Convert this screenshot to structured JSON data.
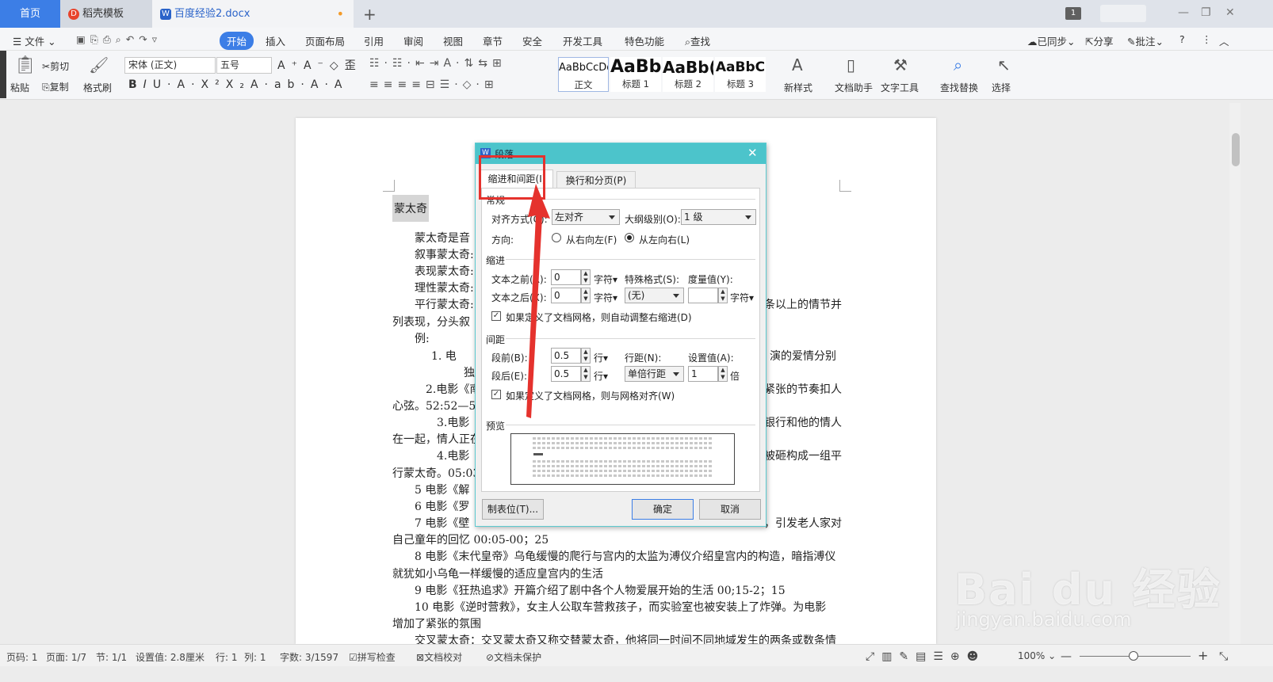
{
  "titlebar": {
    "tab_home": "首页",
    "tab_daoke": "稻壳模板",
    "tab_doc": "百度经验2.docx",
    "page_badge": "1"
  },
  "menubar": {
    "file": "文件",
    "items": [
      "开始",
      "插入",
      "页面布局",
      "引用",
      "审阅",
      "视图",
      "章节",
      "安全",
      "开发工具",
      "特色功能"
    ],
    "search": "查找",
    "sync": "已同步",
    "share": "分享",
    "comment": "批注"
  },
  "ribbon": {
    "paste": "粘贴",
    "cut": "剪切",
    "copy": "复制",
    "format_painter": "格式刷",
    "font_name": "宋体 (正文)",
    "font_size": "五号",
    "styles": [
      {
        "preview": "AaBbCcDd",
        "label": "正文"
      },
      {
        "preview": "AaBb",
        "label": "标题 1"
      },
      {
        "preview": "AaBb(",
        "label": "标题 2"
      },
      {
        "preview": "AaBbC",
        "label": "标题 3"
      }
    ],
    "new_style": "新样式",
    "doc_helper": "文档助手",
    "text_tools": "文字工具",
    "find_replace": "查找替换",
    "select": "选择"
  },
  "document": {
    "heading": "蒙太奇",
    "lines": [
      "蒙太奇是音",
      "叙事蒙太奇:",
      "表现蒙太奇:",
      "理性蒙太奇:",
      "平行蒙太奇:",
      "列表现，分头叙",
      "例:",
      "1.    电",
      "独",
      "2.电影《南",
      "心弦。52:52—54",
      "3.电影",
      "在一起，情人正在",
      "4.电影",
      "行蒙太奇。05:03",
      "5 电影《解",
      "6 电影《罗",
      "7 电影《壁"
    ],
    "right_frag": [
      "条以上的情节并",
      "演的爱情分别",
      "紧张的节奏扣人",
      "银行和他的情人",
      "被砸构成一组平",
      "，引发老人家对"
    ],
    "full": [
      "自己童年的回忆 00:05-00；25",
      "8 电影《末代皇帝》乌龟缓慢的爬行与宫内的太监为溥仪介绍皇宫内的构造，暗指溥仪",
      "就犹如小乌龟一样缓慢的适应皇宫内的生活",
      "9 电影《狂热追求》开篇介绍了剧中各个人物爱展开始的生活 00;15-2；15",
      "10 电影《逆时营救》，女主人公取车营救孩子，而实验室也被安装上了炸弹。为电影",
      "增加了紧张的氛围",
      "交叉蒙太奇：交叉蒙太奇又称交替蒙太奇，他将同一时间不同地域发生的两条或数条情"
    ]
  },
  "dialog": {
    "title": "段落",
    "tab1": "缩进和间距(I)",
    "tab2": "换行和分页(P)",
    "general": "常规",
    "align_label": "对齐方式(G):",
    "align_value": "左对齐",
    "outline_label": "大纲级别(O):",
    "outline_value": "1 级",
    "direction_label": "方向:",
    "rtl": "从右向左(F)",
    "ltr": "从左向右(L)",
    "indent": "缩进",
    "before_text_label": "文本之前(R):",
    "before_text_value": "0",
    "after_text_label": "文本之后(X):",
    "after_text_value": "0",
    "unit_char": "字符",
    "special_label": "特殊格式(S):",
    "special_value": "(无)",
    "measure_label": "度量值(Y):",
    "auto_indent": "如果定义了文档网格，则自动调整右缩进(D)",
    "spacing": "间距",
    "before_label": "段前(B):",
    "before_value": "0.5",
    "after_label": "段后(E):",
    "after_value": "0.5",
    "unit_line": "行",
    "line_spacing_label": "行距(N):",
    "line_spacing_value": "单倍行距",
    "set_value_label": "设置值(A):",
    "set_value": "1",
    "unit_times": "倍",
    "snap_grid": "如果定义了文档网格，则与网格对齐(W)",
    "preview": "预览",
    "tabs_button": "制表位(T)...",
    "ok": "确定",
    "cancel": "取消"
  },
  "status": {
    "page": "页码: 1",
    "pages": "页面: 1/7",
    "section": "节: 1/1",
    "setting": "设置值: 2.8厘米",
    "row": "行: 1",
    "col": "列: 1",
    "words": "字数: 3/1597",
    "spell": "拼写检查",
    "proof": "文档校对",
    "protect": "文档未保护",
    "zoom": "100%"
  },
  "watermark": {
    "brand": "Bai du 经验",
    "url": "jingyan.baidu.com"
  },
  "colors": {
    "accent": "#3c7ee6",
    "dialog_title": "#4cc4cb",
    "highlight": "#e5322d"
  }
}
